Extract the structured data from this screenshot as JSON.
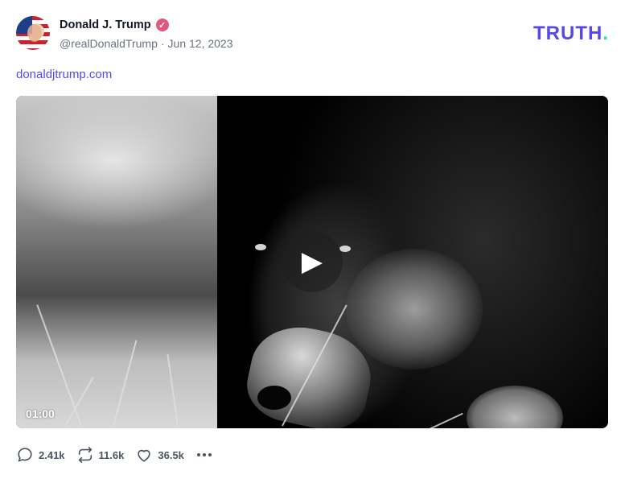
{
  "author": {
    "display_name": "Donald J. Trump",
    "handle": "@realDonaldTrump",
    "separator": "·",
    "date": "Jun 12, 2023",
    "verified_icon": "check-badge-icon"
  },
  "brand": {
    "logo_text": "TRUTH",
    "logo_dot": ".",
    "color": "#5448ee",
    "dot_color": "#17e3c8"
  },
  "post": {
    "link_text": "donaldjtrump.com"
  },
  "video": {
    "duration": "01:00",
    "play_icon": "play-icon"
  },
  "actions": {
    "replies": "2.41k",
    "retruths": "11.6k",
    "likes": "36.5k",
    "reply_icon": "chat-bubble-icon",
    "retruth_icon": "repost-icon",
    "like_icon": "heart-icon",
    "more_icon": "more-horizontal-icon"
  }
}
